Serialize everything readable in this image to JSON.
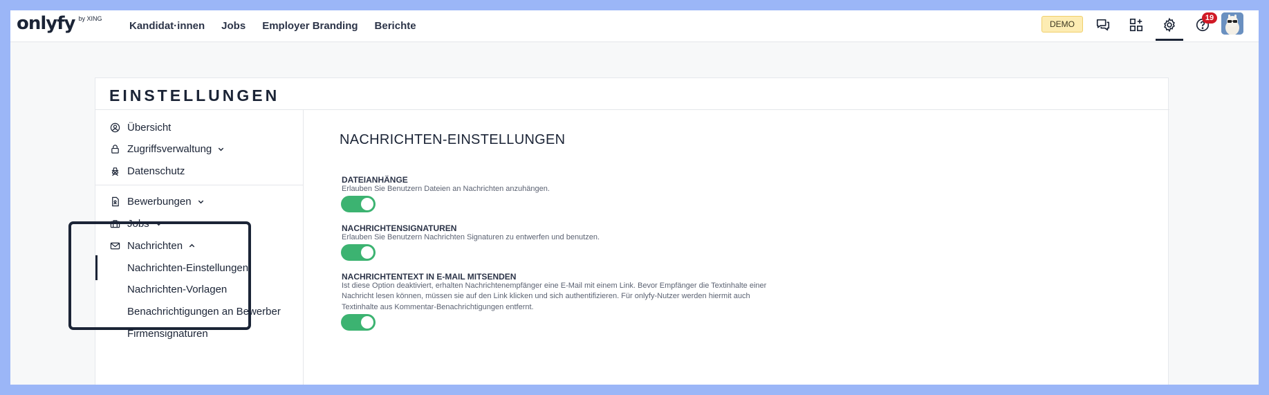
{
  "brand": {
    "logo": "onlyfy",
    "logo_sub": "by XING"
  },
  "nav": {
    "items": [
      {
        "label": "Kandidat·innen"
      },
      {
        "label": "Jobs"
      },
      {
        "label": "Employer Branding"
      },
      {
        "label": "Berichte"
      }
    ]
  },
  "header": {
    "demo_badge": "DEMO",
    "notification_count": "19",
    "icons": [
      "chat-icon",
      "add-widget-icon",
      "gear-icon",
      "help-icon",
      "avatar"
    ]
  },
  "page": {
    "title": "EINSTELLUNGEN"
  },
  "sidebar": {
    "items": [
      {
        "label": "Übersicht",
        "icon": "user-circle-icon"
      },
      {
        "label": "Zugriffsverwaltung",
        "icon": "lock-icon"
      },
      {
        "label": "Datenschutz",
        "icon": "spy-icon"
      },
      {
        "label": "Bewerbungen",
        "icon": "document-icon"
      },
      {
        "label": "Jobs",
        "icon": "briefcase-icon"
      },
      {
        "label": "Nachrichten",
        "icon": "envelope-icon"
      }
    ],
    "sub_items": [
      {
        "label": "Nachrichten-Einstellungen",
        "active": true
      },
      {
        "label": "Nachrichten-Vorlagen"
      },
      {
        "label": "Benachrichtigungen an Bewerber"
      },
      {
        "label": "Firmensignaturen"
      }
    ]
  },
  "main": {
    "heading": "NACHRICHTEN-EINSTELLUNGEN",
    "settings": [
      {
        "title": "DATEIANHÄNGE",
        "description": "Erlauben Sie Benutzern Dateien an Nachrichten anzuhängen.",
        "enabled": true
      },
      {
        "title": "NACHRICHTENSIGNATUREN",
        "description": "Erlauben Sie Benutzern Nachrichten Signaturen zu entwerfen und benutzen.",
        "enabled": true
      },
      {
        "title": "NACHRICHTENTEXT IN E-MAIL MITSENDEN",
        "description_lines": [
          "Ist diese Option deaktiviert, erhalten Nachrichtenempfänger eine E-Mail mit einem Link. Bevor Empfänger die Textinhalte einer",
          "Nachricht lesen können, müssen sie auf den Link klicken und sich authentifizieren. Für onlyfy-Nutzer werden hiermit auch",
          "Textinhalte aus Kommentar-Benachrichtigungen entfernt."
        ],
        "enabled": true
      }
    ]
  },
  "colors": {
    "accent": "#1b2436",
    "toggle_on": "#3cb371",
    "badge": "#d01a26",
    "demo": "#fdecb3"
  }
}
